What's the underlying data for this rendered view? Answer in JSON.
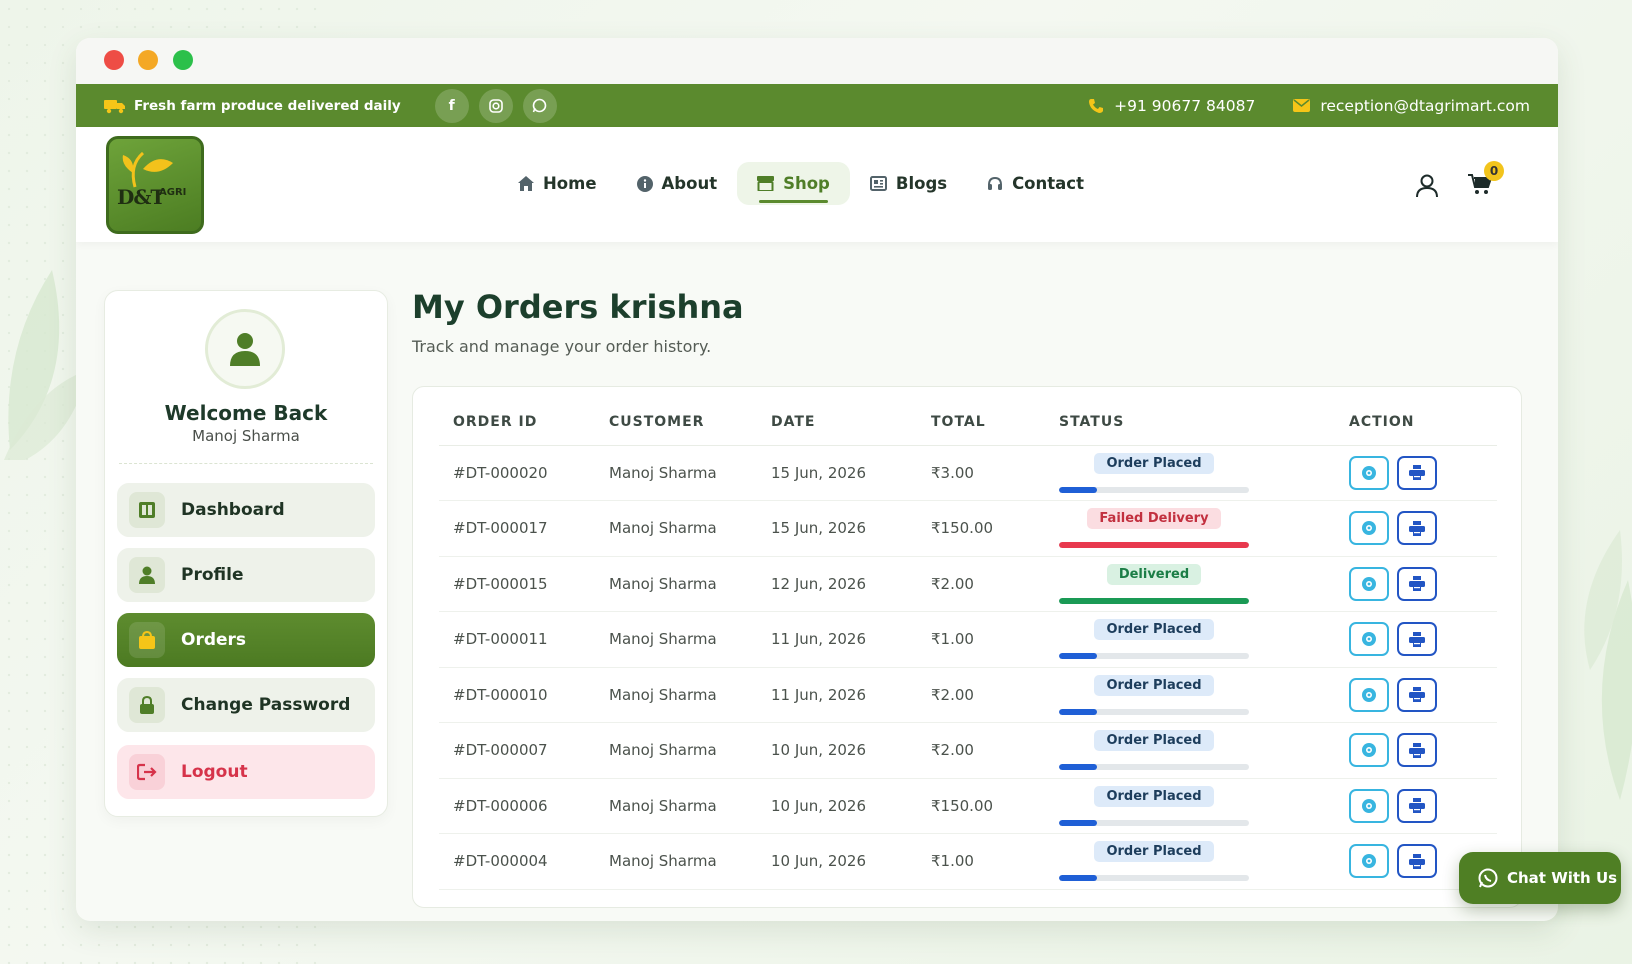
{
  "topbar": {
    "promo": "Fresh farm produce delivered daily",
    "phone": "+91 90677 84087",
    "email": "reception@dtagrimart.com",
    "socials": [
      "facebook-icon",
      "instagram-icon",
      "whatsapp-icon"
    ]
  },
  "logo": {
    "text": "D&T",
    "sub": "AGRI"
  },
  "nav": {
    "items": [
      {
        "label": "Home",
        "icon": "home-icon"
      },
      {
        "label": "About",
        "icon": "info-icon"
      },
      {
        "label": "Shop",
        "icon": "store-icon",
        "active": true
      },
      {
        "label": "Blogs",
        "icon": "newspaper-icon"
      },
      {
        "label": "Contact",
        "icon": "headset-icon"
      }
    ],
    "cart_count": "0"
  },
  "sidebar": {
    "welcome": "Welcome Back",
    "user_name": "Manoj Sharma",
    "items": [
      {
        "label": "Dashboard",
        "icon": "dashboard-icon"
      },
      {
        "label": "Profile",
        "icon": "user-icon"
      },
      {
        "label": "Orders",
        "icon": "shopping-bag-icon",
        "active": true
      },
      {
        "label": "Change Password",
        "icon": "lock-icon"
      },
      {
        "label": "Logout",
        "icon": "logout-icon"
      }
    ]
  },
  "page": {
    "title": "My Orders krishna",
    "subtitle": "Track and manage your order history."
  },
  "table": {
    "columns": [
      "ORDER ID",
      "CUSTOMER",
      "DATE",
      "TOTAL",
      "STATUS",
      "ACTION"
    ],
    "rows": [
      {
        "id": "#DT-000020",
        "customer": "Manoj Sharma",
        "date": "15 Jun, 2026",
        "total": "₹3.00",
        "status": "Order Placed",
        "progress": 0.2
      },
      {
        "id": "#DT-000017",
        "customer": "Manoj Sharma",
        "date": "15 Jun, 2026",
        "total": "₹150.00",
        "status": "Failed Delivery",
        "progress": 1.0
      },
      {
        "id": "#DT-000015",
        "customer": "Manoj Sharma",
        "date": "12 Jun, 2026",
        "total": "₹2.00",
        "status": "Delivered",
        "progress": 1.0
      },
      {
        "id": "#DT-000011",
        "customer": "Manoj Sharma",
        "date": "11 Jun, 2026",
        "total": "₹1.00",
        "status": "Order Placed",
        "progress": 0.2
      },
      {
        "id": "#DT-000010",
        "customer": "Manoj Sharma",
        "date": "11 Jun, 2026",
        "total": "₹2.00",
        "status": "Order Placed",
        "progress": 0.2
      },
      {
        "id": "#DT-000007",
        "customer": "Manoj Sharma",
        "date": "10 Jun, 2026",
        "total": "₹2.00",
        "status": "Order Placed",
        "progress": 0.2
      },
      {
        "id": "#DT-000006",
        "customer": "Manoj Sharma",
        "date": "10 Jun, 2026",
        "total": "₹150.00",
        "status": "Order Placed",
        "progress": 0.2
      },
      {
        "id": "#DT-000004",
        "customer": "Manoj Sharma",
        "date": "10 Jun, 2026",
        "total": "₹1.00",
        "status": "Order Placed",
        "progress": 0.2
      }
    ]
  },
  "chat": {
    "label": "Chat With Us"
  },
  "colors": {
    "brand": "#5b8a2e",
    "placed": "#1f5fd6",
    "failed": "#e8394e",
    "delivered": "#1a9a55"
  }
}
